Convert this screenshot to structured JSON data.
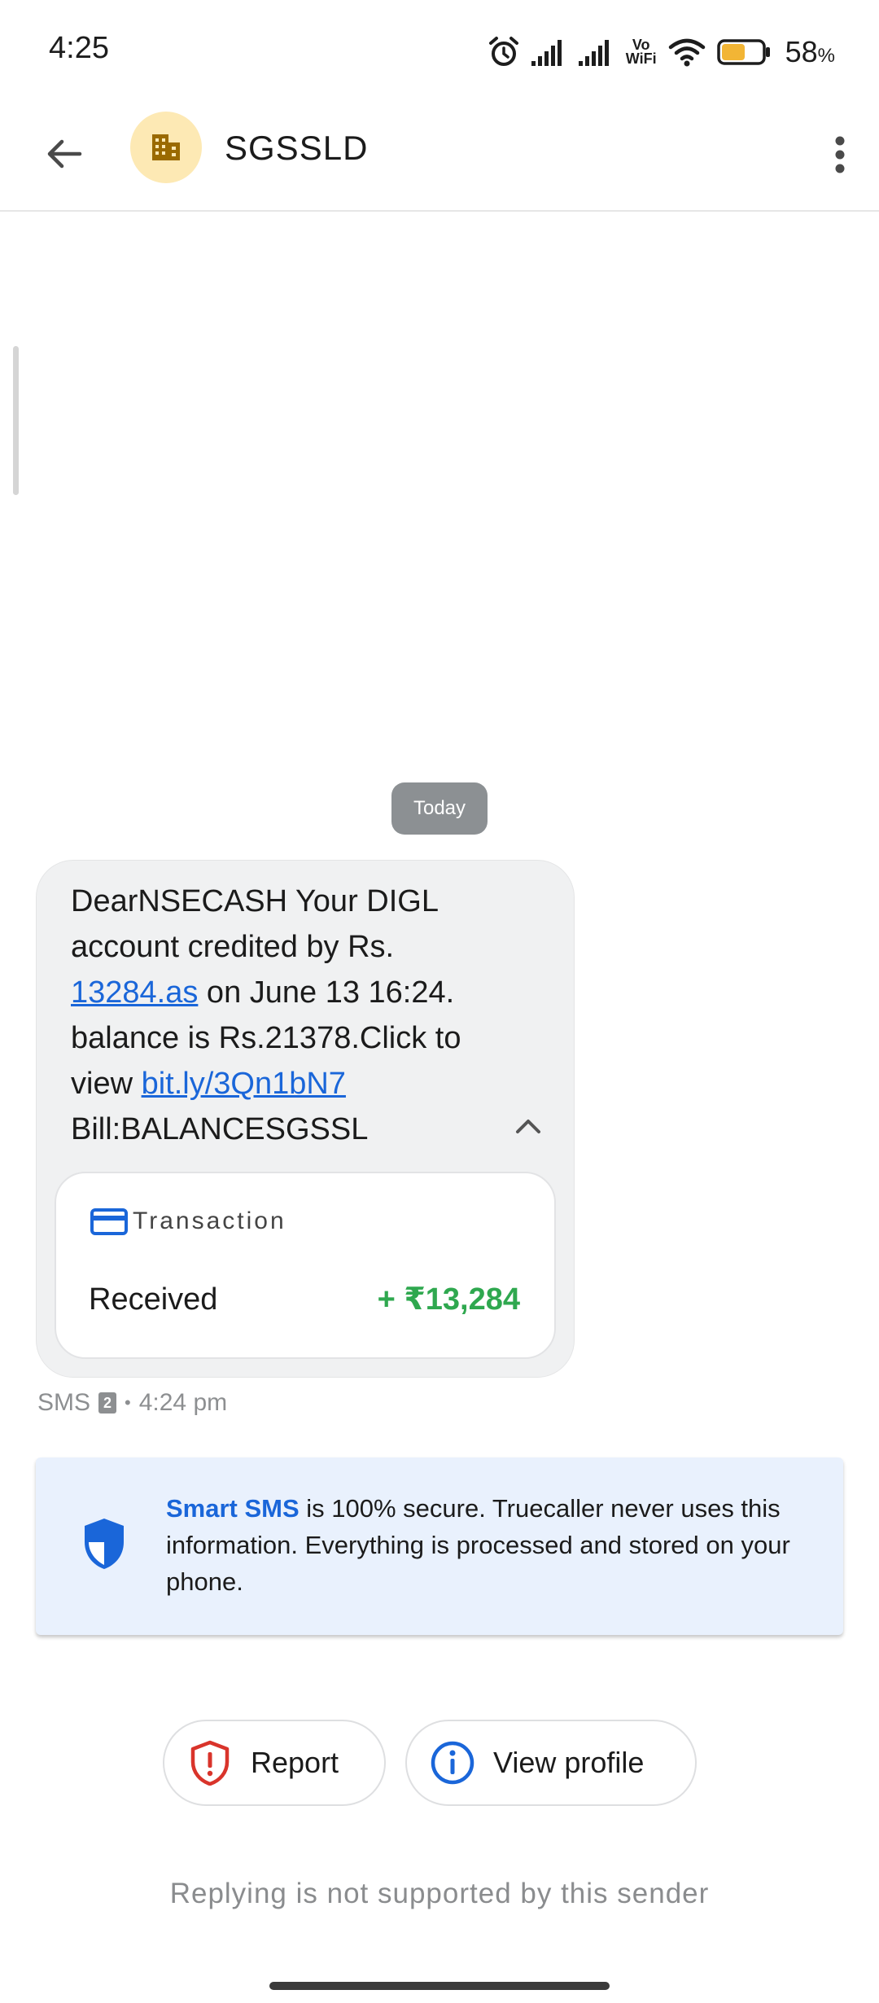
{
  "status_bar": {
    "time": "4:25",
    "vowifi_top": "Vo",
    "vowifi_bottom": "WiFi",
    "battery_percent": "58",
    "battery_unit": "%",
    "battery_level": 0.58,
    "battery_color": "#f2b535"
  },
  "header": {
    "title": "SGSSLD",
    "avatar_icon": "building-icon",
    "avatar_bg": "#fde9b4"
  },
  "thread": {
    "date_chip": "Today",
    "message": {
      "part1": "DearNSECASH Your DIGL account credited by Rs. ",
      "link1": "13284.as",
      "part2": " on June 13 16:24. balance is Rs.21378.Click to view ",
      "link2": "bit.ly/3Qn1bN7",
      "part3": " Bill:BALANCESGSSL"
    },
    "transaction": {
      "header": "Transaction",
      "type": "Received",
      "amount": "+ ₹13,284",
      "amount_color": "#2fa84f"
    },
    "meta": {
      "channel": "SMS",
      "sim": "2",
      "separator": "•",
      "time": "4:24 pm"
    }
  },
  "secure_notice": {
    "brand": "Smart SMS",
    "text": " is 100% secure. Truecaller never uses this information. Everything is processed and stored on your phone."
  },
  "actions": {
    "report_label": "Report",
    "view_profile_label": "View profile"
  },
  "footer": {
    "reply_note": "Replying is not supported by this sender"
  },
  "colors": {
    "link": "#1a66d9",
    "report_red": "#d9342b"
  }
}
